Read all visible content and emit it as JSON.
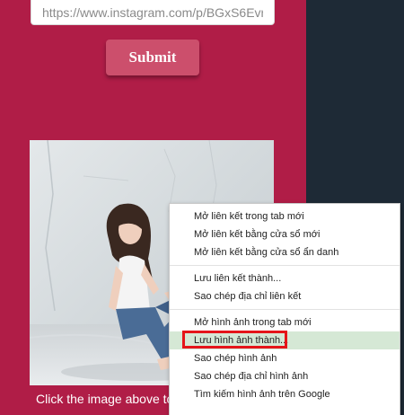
{
  "form": {
    "url_value": "https://www.instagram.com/p/BGxS6Evr",
    "submit_label": "Submit"
  },
  "caption": "Click the image above to",
  "context_menu": {
    "items": [
      {
        "label": "Mở liên kết trong tab mới"
      },
      {
        "label": "Mở liên kết bằng cửa sổ mới"
      },
      {
        "label": "Mở liên kết bằng cửa sổ ẩn danh"
      },
      {
        "label": "Lưu liên kết thành..."
      },
      {
        "label": "Sao chép địa chỉ liên kết"
      },
      {
        "label": "Mở hình ảnh trong tab mới"
      },
      {
        "label": "Lưu hình ảnh thành..."
      },
      {
        "label": "Sao chép hình ảnh"
      },
      {
        "label": "Sao chép địa chỉ hình ảnh"
      },
      {
        "label": "Tìm kiếm hình ảnh trên Google"
      }
    ],
    "highlighted_label": "Lưu hình ảnh thành..."
  },
  "colors": {
    "page_background": "#b01d47",
    "right_panel": "#1e2a36",
    "submit_button": "#cc4f6c",
    "menu_highlight": "#d5e8d5",
    "annotation_box": "#e5151a"
  }
}
